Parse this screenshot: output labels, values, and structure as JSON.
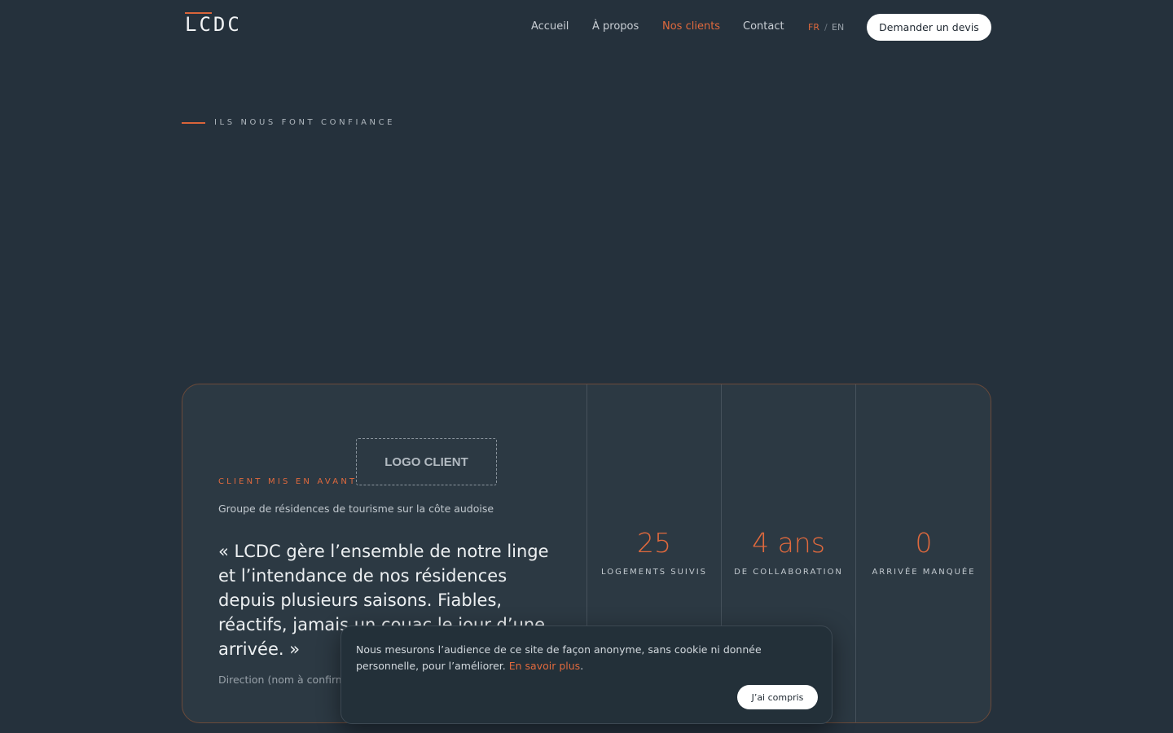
{
  "header": {
    "logo": "LCDC",
    "nav": [
      "Accueil",
      "À propos",
      "Nos clients",
      "Contact"
    ],
    "active_nav": "Nos clients",
    "lang": {
      "fr": "FR",
      "separator": "/",
      "en": "EN",
      "active": "FR"
    },
    "cta_label": "Demander un devis"
  },
  "section": {
    "label": "ILS NOUS FONT CONFIANCE"
  },
  "featured": {
    "logo_placeholder": "LOGO CLIENT",
    "label": "CLIENT MIS EN AVANT",
    "description": "Groupe de résidences de tourisme sur la côte audoise",
    "quote": "« LCDC gère l’ensemble de notre linge et l’intendance de nos résidences depuis plusieurs saisons. Fiables, réactifs, jamais un couac le jour d’une arrivée. »",
    "author": "Direction (nom à confirmer)"
  },
  "stats": [
    {
      "value": "25",
      "label": "LOGEMENTS SUIVIS"
    },
    {
      "value": "4 ans",
      "label": "DE COLLABORATION"
    },
    {
      "value": "0",
      "label": "ARRIVÉE MANQUÉE"
    }
  ],
  "cookie": {
    "text": "Nous mesurons l’audience de ce site de façon anonyme, sans cookie ni donnée personnelle, pour l’améliorer.",
    "link": "En savoir plus",
    "after_link": ".",
    "button": "J’ai compris"
  },
  "colors": {
    "accent": "#e0693d",
    "background": "#25313c",
    "card": "#2c3943"
  }
}
